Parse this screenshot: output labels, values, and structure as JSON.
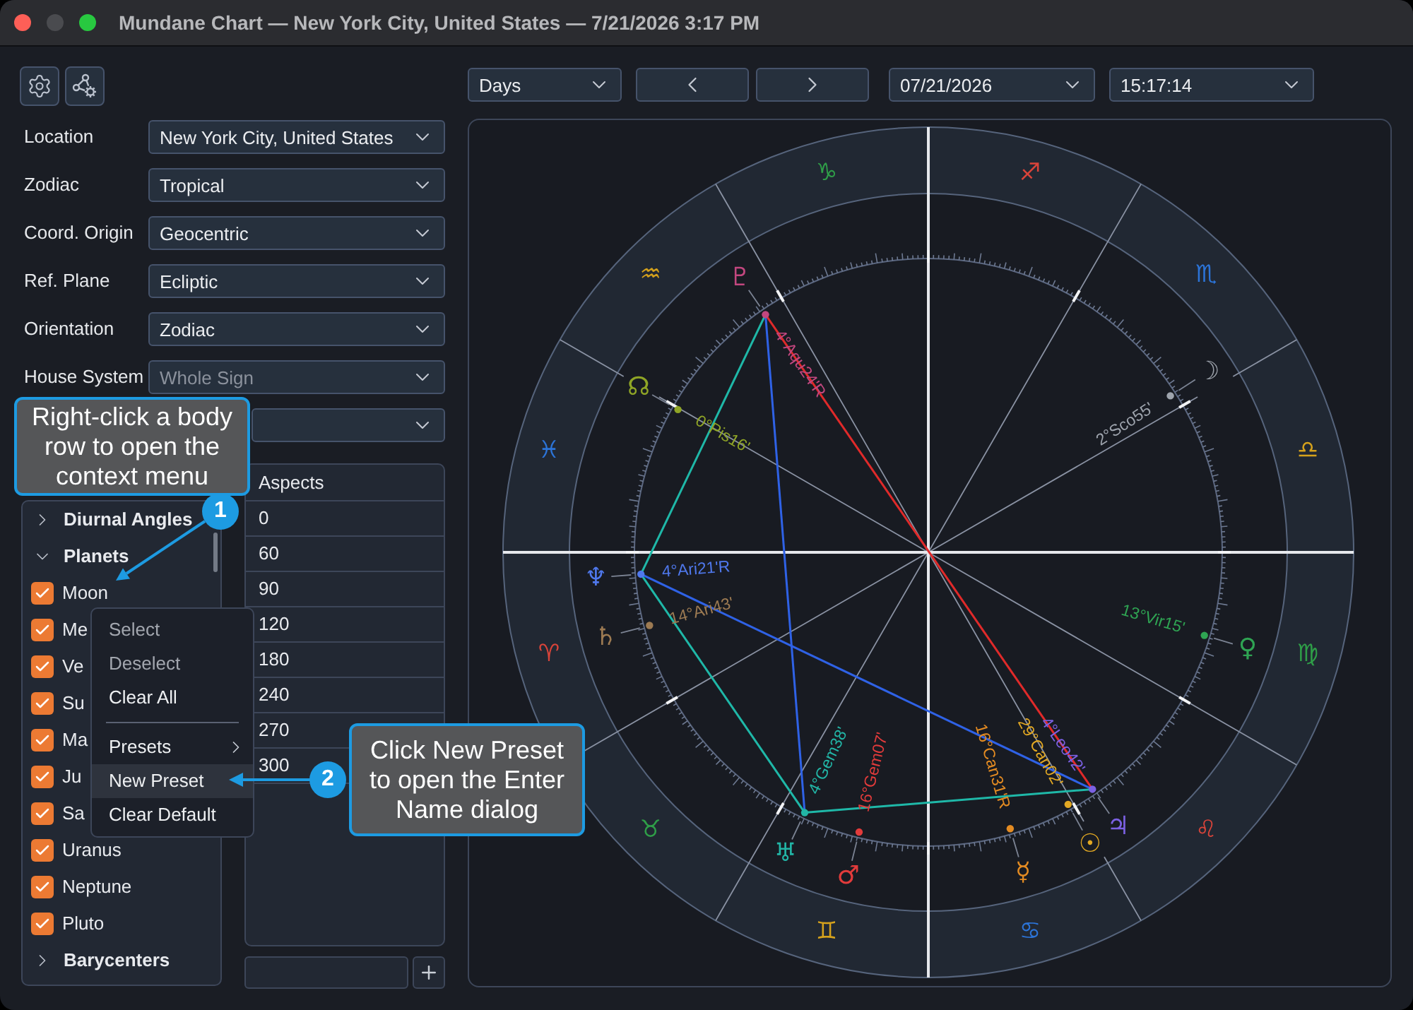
{
  "window": {
    "title": "Mundane Chart — New York City, United States — 7/21/2026 3:17 PM"
  },
  "settings": [
    {
      "label": "Location",
      "value": "New York City, United States",
      "disabled": false
    },
    {
      "label": "Zodiac",
      "value": "Tropical",
      "disabled": false
    },
    {
      "label": "Coord. Origin",
      "value": "Geocentric",
      "disabled": false
    },
    {
      "label": "Ref. Plane",
      "value": "Ecliptic",
      "disabled": false
    },
    {
      "label": "Orientation",
      "value": "Zodiac",
      "disabled": false
    },
    {
      "label": "House System",
      "value": "Whole Sign",
      "disabled": true
    }
  ],
  "bodies_panel": {
    "groups": [
      {
        "label": "Diurnal Angles",
        "expanded": false
      },
      {
        "label": "Planets",
        "expanded": true,
        "children": [
          {
            "label": "Moon",
            "checked": true
          },
          {
            "label": "Me",
            "checked": true
          },
          {
            "label": "Ve",
            "checked": true
          },
          {
            "label": "Su",
            "checked": true
          },
          {
            "label": "Ma",
            "checked": true
          },
          {
            "label": "Ju",
            "checked": true
          },
          {
            "label": "Sa",
            "checked": true
          },
          {
            "label": "Uranus",
            "checked": true
          },
          {
            "label": "Neptune",
            "checked": true
          },
          {
            "label": "Pluto",
            "checked": true
          }
        ]
      },
      {
        "label": "Barycenters",
        "expanded": false
      }
    ]
  },
  "context_menu": {
    "items": [
      {
        "kind": "item",
        "label": "Select",
        "disabled": true,
        "selected": false
      },
      {
        "kind": "item",
        "label": "Deselect",
        "disabled": true,
        "selected": false
      },
      {
        "kind": "item",
        "label": "Clear All",
        "disabled": false,
        "selected": false
      },
      {
        "kind": "separator"
      },
      {
        "kind": "submenu",
        "label": "Presets",
        "disabled": false,
        "selected": false
      },
      {
        "kind": "item",
        "label": "New Preset",
        "disabled": false,
        "selected": true
      },
      {
        "kind": "item",
        "label": "Clear Default",
        "disabled": false,
        "selected": false
      }
    ]
  },
  "aspects_panel": {
    "header": "Aspects",
    "rows": [
      "0",
      "60",
      "90",
      "120",
      "180",
      "240",
      "270",
      "300"
    ]
  },
  "chart_toolbar": {
    "interval": "Days",
    "date": "07/21/2026",
    "time": "15:17:14"
  },
  "chart": {
    "signs": [
      {
        "glyph": "♈",
        "color": "#d9443a"
      },
      {
        "glyph": "♉",
        "color": "#2f9e48"
      },
      {
        "glyph": "♊",
        "color": "#d6a21c"
      },
      {
        "glyph": "♋",
        "color": "#2c74d8"
      },
      {
        "glyph": "♌",
        "color": "#d9443a"
      },
      {
        "glyph": "♍",
        "color": "#2f9e48"
      },
      {
        "glyph": "♎",
        "color": "#d6a21c"
      },
      {
        "glyph": "♏",
        "color": "#2c74d8"
      },
      {
        "glyph": "♐",
        "color": "#d9443a"
      },
      {
        "glyph": "♑",
        "color": "#2f9e48"
      },
      {
        "glyph": "♒",
        "color": "#d6a21c"
      },
      {
        "glyph": "♓",
        "color": "#2c74d8"
      }
    ],
    "bodies": [
      {
        "glyph": "♇",
        "label": "4°Aqu24'R",
        "color": "#c2477f"
      },
      {
        "glyph": "☊",
        "label": "0°Pis16'",
        "color": "#8fa526"
      },
      {
        "glyph": "☽",
        "label": "2°Sco55'",
        "color": "#9ea4ad"
      },
      {
        "glyph": "♆",
        "label": "4°Ari21'R",
        "color": "#4f78ec"
      },
      {
        "glyph": "♄",
        "label": "14°Ari43'",
        "color": "#9c7a52"
      },
      {
        "glyph": "♅",
        "label": "4°Gem38'",
        "color": "#22b5a6"
      },
      {
        "glyph": "♂",
        "label": "16°Gem07'",
        "color": "#e23b3b"
      },
      {
        "glyph": "☿",
        "label": "16°Can31'R",
        "color": "#e38b22"
      },
      {
        "glyph": "☉",
        "label": "29°Can02'",
        "color": "#e2a823"
      },
      {
        "glyph": "♃",
        "label": "4°Leo42'",
        "color": "#7b61e3"
      },
      {
        "glyph": "♀",
        "label": "13°Vir15'",
        "color": "#2fa453"
      }
    ],
    "aspects": [
      {
        "kind": "opposition"
      },
      {
        "kind": "sextile"
      },
      {
        "kind": "trine"
      },
      {
        "kind": "sextile"
      },
      {
        "kind": "trine"
      },
      {
        "kind": "sextile"
      }
    ]
  },
  "callouts": [
    {
      "number": "1",
      "text": "Right-click a body row to open the context menu"
    },
    {
      "number": "2",
      "text": "Click New Preset to open the Enter Name dialog"
    }
  ]
}
